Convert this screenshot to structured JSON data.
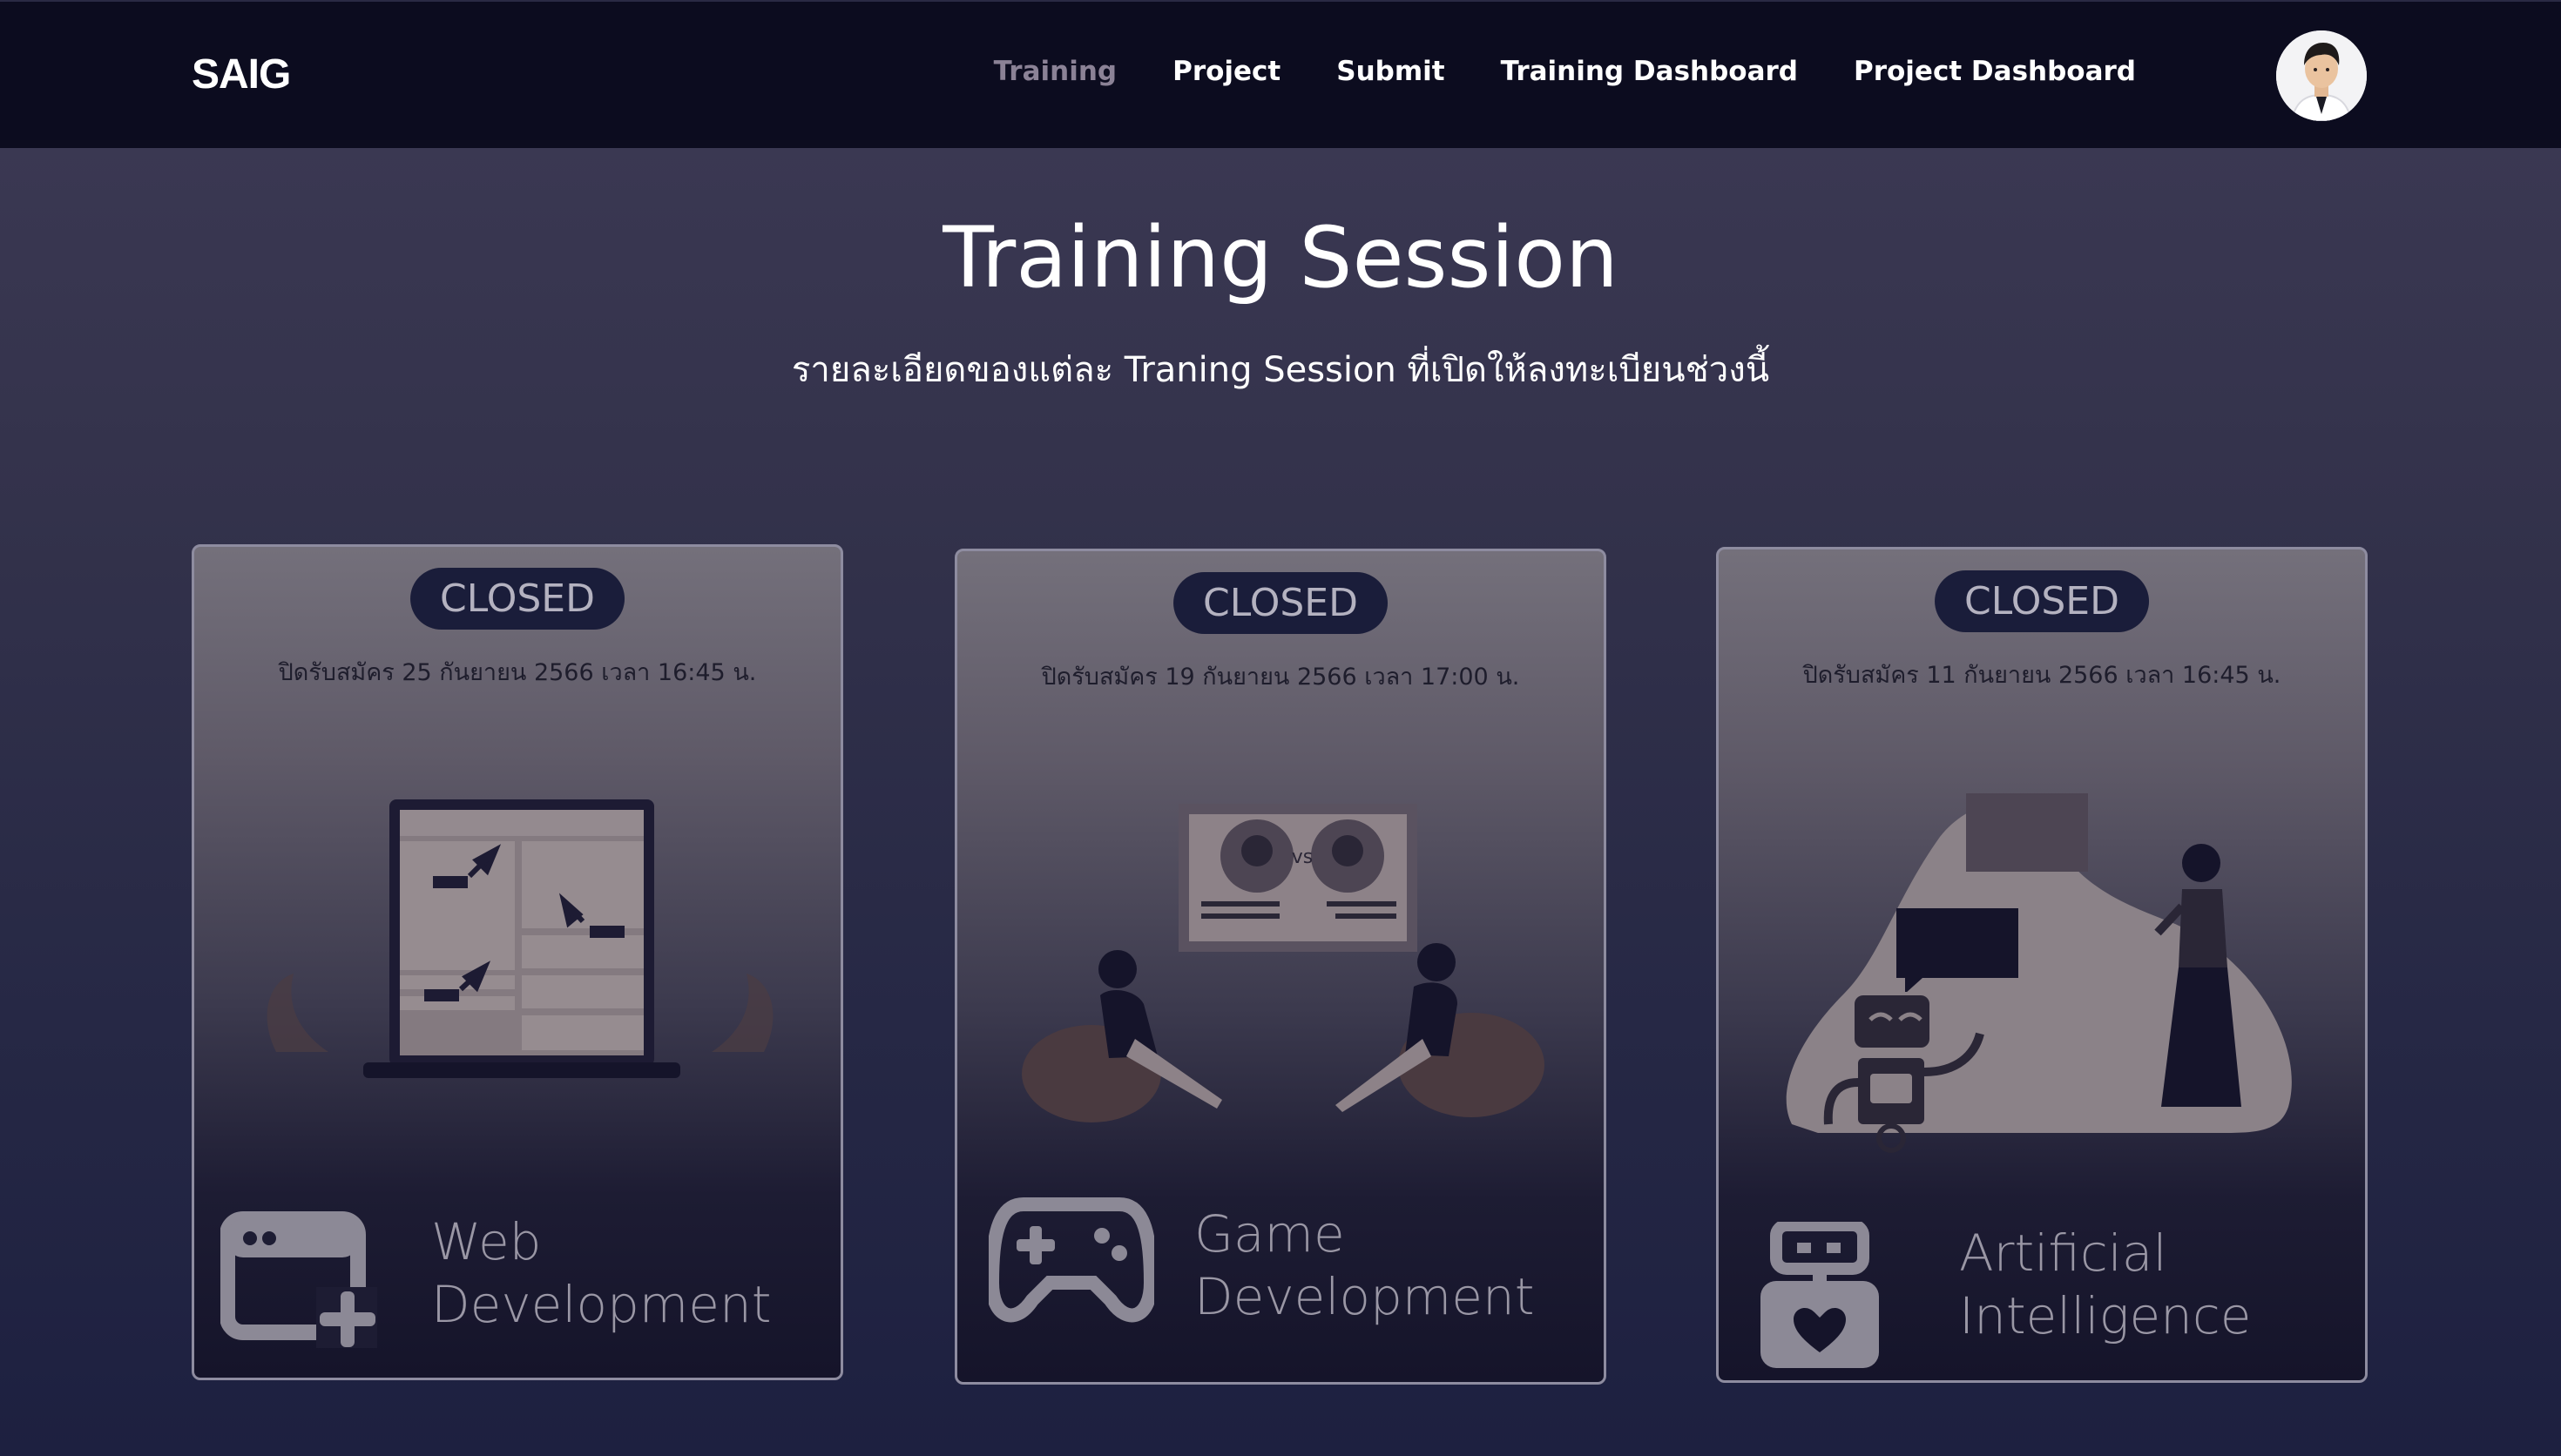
{
  "nav": {
    "brand": "SAIG",
    "links": [
      {
        "label": "Training",
        "active": true
      },
      {
        "label": "Project",
        "active": false
      },
      {
        "label": "Submit",
        "active": false
      },
      {
        "label": "Training Dashboard",
        "active": false
      },
      {
        "label": "Project Dashboard",
        "active": false
      }
    ],
    "avatar_icon": "user-avatar"
  },
  "hero": {
    "title": "Training Session",
    "subtitle": "รายละเอียดของแต่ละ Traning Session ที่เปิดให้ลงทะเบียนช่วงนี้"
  },
  "cards": [
    {
      "status": "CLOSED",
      "closing": "ปิดรับสมัคร 25 กันยายน 2566 เวลา 16:45 น.",
      "title_line1": "Web",
      "title_line2": "Development",
      "icon": "web-window-add-icon",
      "illustration": "laptop-cursors"
    },
    {
      "status": "CLOSED",
      "closing": "ปิดรับสมัคร 19 กันยายน 2566 เวลา 17:00 น.",
      "title_line1": "Game",
      "title_line2": "Development",
      "icon": "gamepad-icon",
      "illustration": "two-gamers-vs-screen"
    },
    {
      "status": "CLOSED",
      "closing": "ปิดรับสมัคร 11 กันยายน 2566 เวลา 16:45 น.",
      "title_line1": "Artificial",
      "title_line2": "Intelligence",
      "icon": "robot-heart-icon",
      "illustration": "robot-and-woman-chat"
    }
  ],
  "colors": {
    "navbar": "#0c0c1f",
    "badge": "#1a1d3a",
    "active_nav": "#8b8296"
  }
}
